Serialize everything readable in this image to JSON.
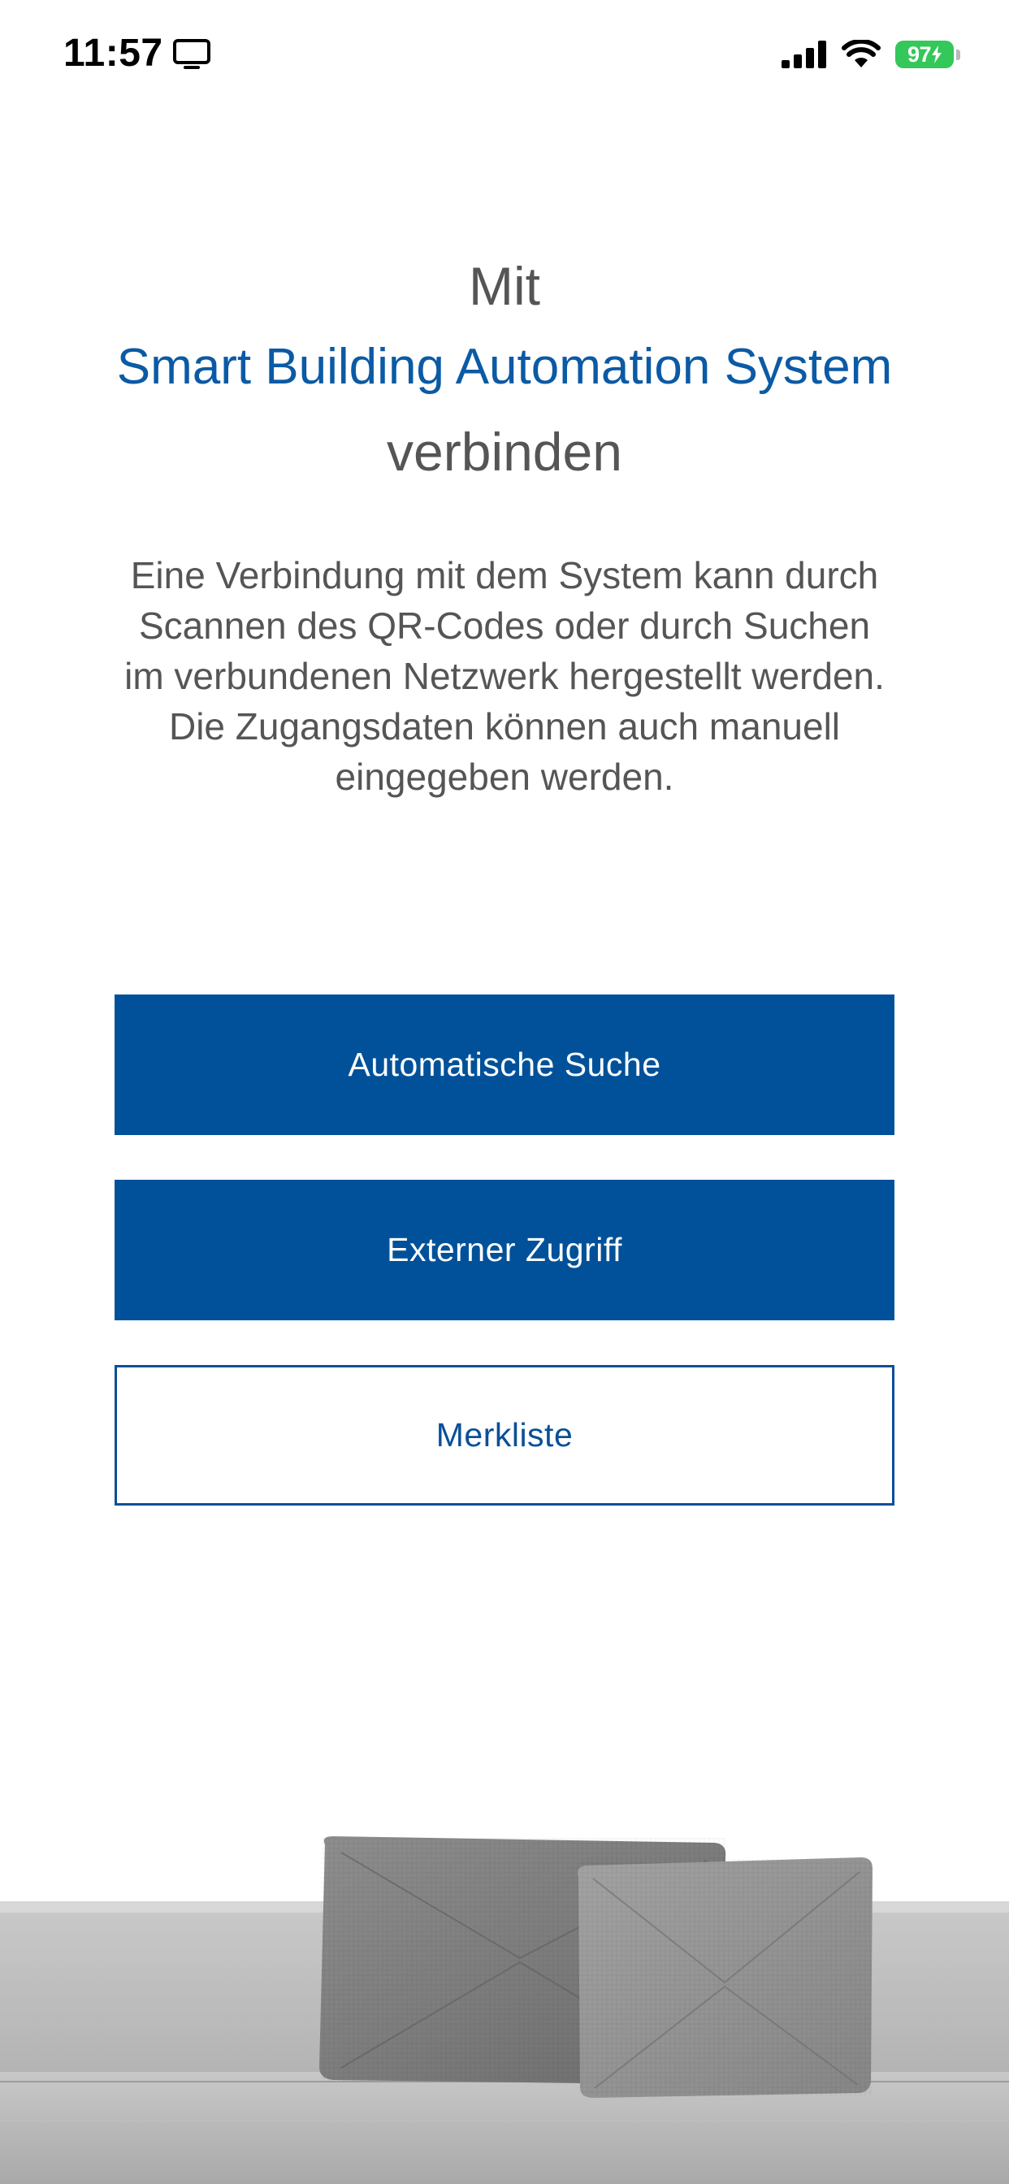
{
  "status_bar": {
    "time": "11:57",
    "left_icon": "screen-mirroring-icon",
    "signal_icon": "cellular-signal-icon",
    "wifi_icon": "wifi-icon",
    "battery_level": "97",
    "battery_color": "#34c759"
  },
  "heading": {
    "line1": "Mit",
    "line2": "Smart Building Automation System",
    "line3": "verbinden"
  },
  "description": "Eine Verbindung mit dem System kann durch Scannen des QR-Codes oder durch Suchen im verbundenen Netzwerk hergestellt werden. Die Zugangsdaten können auch manuell eingegeben werden.",
  "buttons": {
    "auto_search": "Automatische Suche",
    "external_access": "Externer Zugriff",
    "watchlist": "Merkliste"
  },
  "colors": {
    "accent": "#00519a",
    "heading_link": "#0b5aa5",
    "text": "#555555"
  },
  "illustration": "sofa-with-cushions-image"
}
